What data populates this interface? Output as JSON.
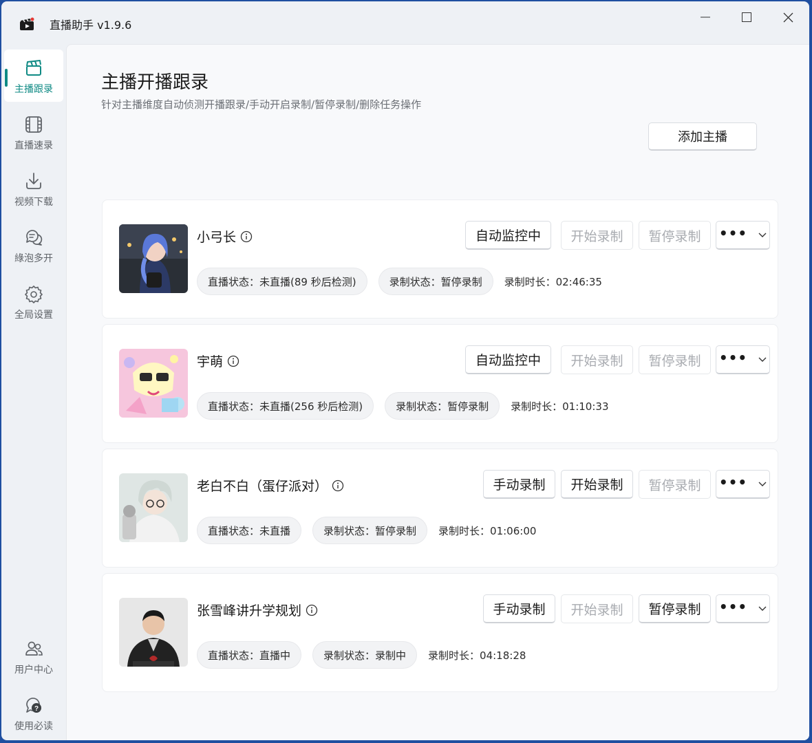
{
  "app": {
    "title": "直播助手 v1.9.6"
  },
  "sidebar": {
    "items": [
      {
        "label": "主播跟录",
        "icon": "clapperboard-icon",
        "active": true
      },
      {
        "label": "直播速录",
        "icon": "film-frame-icon",
        "active": false
      },
      {
        "label": "视频下载",
        "icon": "download-icon",
        "active": false
      },
      {
        "label": "綠泡多开",
        "icon": "chat-bubbles-icon",
        "active": false
      },
      {
        "label": "全局设置",
        "icon": "gear-icon",
        "active": false
      }
    ],
    "bottom_items": [
      {
        "label": "用户中心",
        "icon": "users-icon"
      },
      {
        "label": "使用必读",
        "icon": "help-search-icon"
      }
    ]
  },
  "page": {
    "title": "主播开播跟录",
    "subtitle": "针对主播维度自动侦测开播跟录/手动开启录制/暂停录制/删除任务操作",
    "add_button": "添加主播"
  },
  "streamers": [
    {
      "name": "小弓长",
      "live_status": "直播状态：未直播(89 秒后检测)",
      "record_status": "录制状态：暂停录制",
      "duration": "录制时长：02:46:35",
      "mode_button": "自动监控中",
      "start_button": "开始录制",
      "pause_button": "暂停录制",
      "start_enabled": false,
      "pause_enabled": false
    },
    {
      "name": "宇萌",
      "live_status": "直播状态：未直播(256 秒后检测)",
      "record_status": "录制状态：暂停录制",
      "duration": "录制时长：01:10:33",
      "mode_button": "自动监控中",
      "start_button": "开始录制",
      "pause_button": "暂停录制",
      "start_enabled": false,
      "pause_enabled": false
    },
    {
      "name": "老白不白（蛋仔派对）",
      "live_status": "直播状态：未直播",
      "record_status": "录制状态：暂停录制",
      "duration": "录制时长：01:06:00",
      "mode_button": "手动录制",
      "start_button": "开始录制",
      "pause_button": "暂停录制",
      "start_enabled": true,
      "pause_enabled": false
    },
    {
      "name": "张雪峰讲升学规划",
      "live_status": "直播状态：直播中",
      "record_status": "录制状态：录制中",
      "duration": "录制时长：04:18:28",
      "mode_button": "手动录制",
      "start_button": "开始录制",
      "pause_button": "暂停录制",
      "start_enabled": false,
      "pause_enabled": true
    }
  ],
  "colors": {
    "accent": "#0f8a84",
    "disabled_text": "#a8abb0"
  }
}
